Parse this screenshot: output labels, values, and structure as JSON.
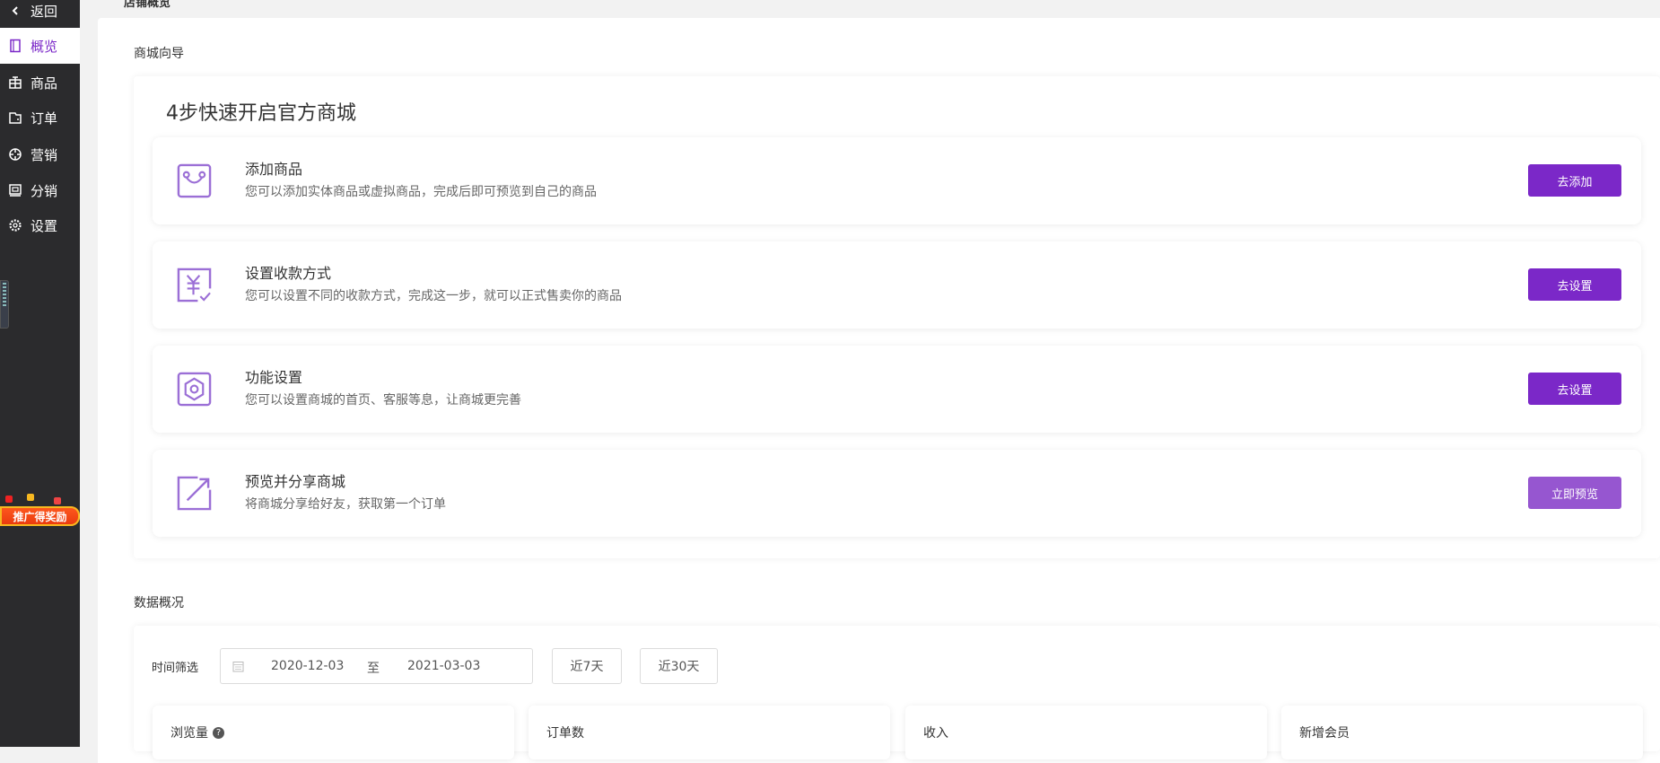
{
  "sidebar": {
    "back": "返回",
    "items": [
      {
        "label": "概览",
        "icon": "book-icon"
      },
      {
        "label": "商品",
        "icon": "gift-icon"
      },
      {
        "label": "订单",
        "icon": "wallet-icon"
      },
      {
        "label": "营销",
        "icon": "target-icon"
      },
      {
        "label": "分销",
        "icon": "share-box-icon"
      },
      {
        "label": "设置",
        "icon": "gear-icon"
      }
    ],
    "promo": "推广得奖励"
  },
  "breadcrumb": {
    "current": "店铺概览",
    "sep": "/"
  },
  "guide": {
    "section": "商城向导",
    "title": "4步快速开启官方商城",
    "steps": [
      {
        "title": "添加商品",
        "desc": "您可以添加实体商品或虚拟商品，完成后即可预览到自己的商品",
        "button": "去添加"
      },
      {
        "title": "设置收款方式",
        "desc": "您可以设置不同的收款方式，完成这一步，就可以正式售卖你的商品",
        "button": "去设置"
      },
      {
        "title": "功能设置",
        "desc": "您可以设置商城的首页、客服等息，让商城更完善",
        "button": "去设置"
      },
      {
        "title": "预览并分享商城",
        "desc": "将商城分享给好友，获取第一个订单",
        "button": "立即预览"
      }
    ]
  },
  "data": {
    "section": "数据概况",
    "filter_label": "时间筛选",
    "start": "2020-12-03",
    "to": "至",
    "end": "2021-03-03",
    "last7": "近7天",
    "last30": "近30天",
    "stats": [
      {
        "label": "浏览量",
        "help": "?"
      },
      {
        "label": "订单数"
      },
      {
        "label": "收入"
      },
      {
        "label": "新增会员"
      }
    ]
  },
  "colors": {
    "accent": "#7b28c8",
    "accent_light": "#9656d0",
    "sidebar": "#2b2b2d"
  }
}
